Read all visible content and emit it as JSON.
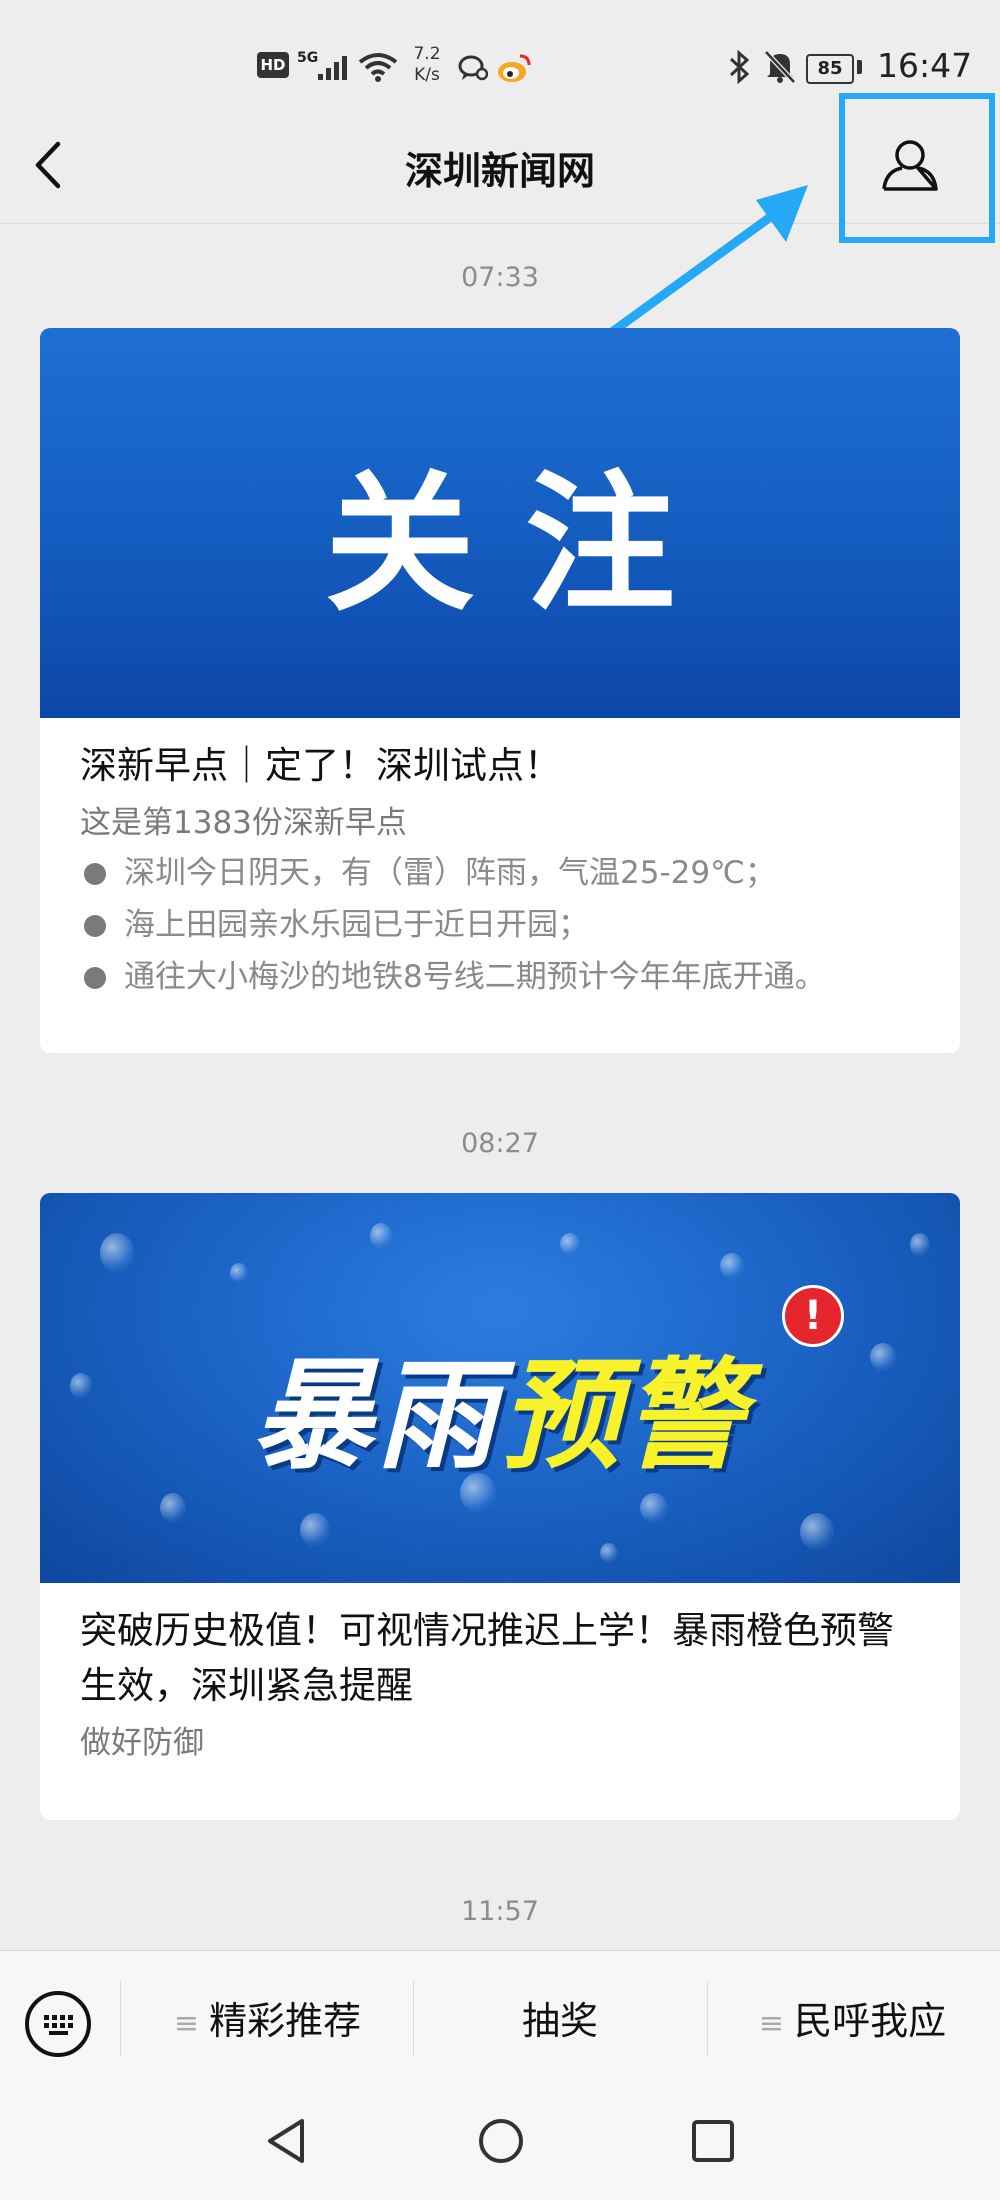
{
  "status_bar": {
    "hd": "HD",
    "network": "5G",
    "speed_value": "7.2",
    "speed_unit": "K/s",
    "battery": "85",
    "time": "16:47"
  },
  "header": {
    "title": "深圳新闻网"
  },
  "feed": [
    {
      "time": "07:33",
      "banner_text": "关注",
      "title": "深新早点｜定了！深圳试点！",
      "subtitle": "这是第1383份深新早点",
      "bullets": [
        "深圳今日阴天，有（雷）阵雨，气温25-29℃；",
        "海上田园亲水乐园已于近日开园；",
        "通往大小梅沙的地铁8号线二期预计今年年底开通。"
      ]
    },
    {
      "time": "08:27",
      "banner_text_white": "暴雨",
      "banner_text_yellow": "预警",
      "title": "突破历史极值！可视情况推迟上学！暴雨橙色预警生效，深圳紧急提醒",
      "subtitle": "做好防御"
    },
    {
      "time": "11:57"
    }
  ],
  "menu": {
    "items": [
      "精彩推荐",
      "抽奖",
      "民呼我应"
    ]
  },
  "colors": {
    "highlight": "#25a8f5",
    "banner_blue": "#1a62c4",
    "warning_yellow": "#f7f22a"
  }
}
